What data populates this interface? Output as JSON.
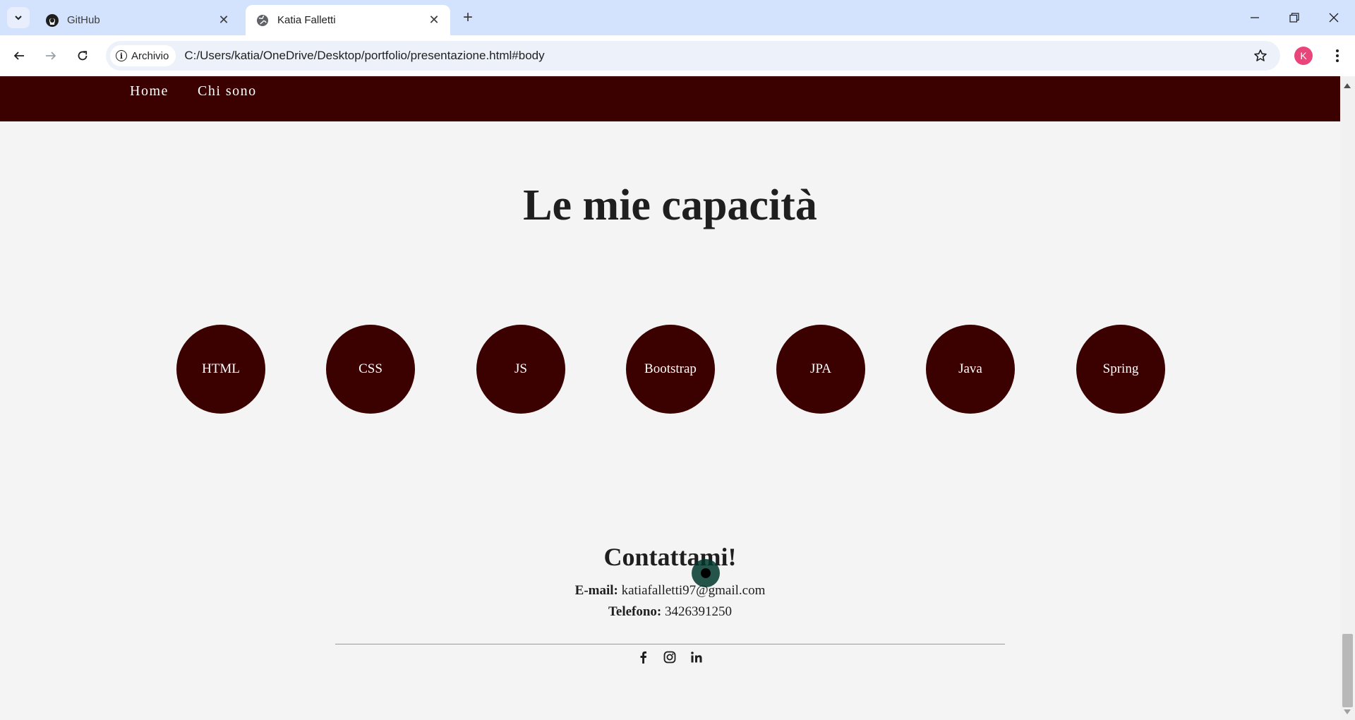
{
  "browser": {
    "tabs": [
      {
        "title": "GitHub",
        "icon": "github-icon",
        "active": false
      },
      {
        "title": "Katia Falletti",
        "icon": "globe-icon",
        "active": true
      }
    ],
    "address": {
      "chip_label": "Archivio",
      "url": "C:/Users/katia/OneDrive/Desktop/portfolio/presentazione.html#body"
    },
    "profile_initial": "K",
    "profile_color": "#e8457a"
  },
  "site": {
    "nav": [
      "Home",
      "Chi sono"
    ],
    "heading": "Le mie capacità",
    "skills": [
      "HTML",
      "CSS",
      "JS",
      "Bootstrap",
      "JPA",
      "Java",
      "Spring"
    ],
    "contact": {
      "title": "Contattami!",
      "email_label": "E-mail:",
      "email_value": "katiafalletti97@gmail.com",
      "phone_label": "Telefono:",
      "phone_value": "3426391250"
    },
    "social": [
      "facebook-icon",
      "instagram-icon",
      "linkedin-icon"
    ],
    "colors": {
      "brand": "#3b0000",
      "page_bg": "#f4f4f4"
    }
  }
}
